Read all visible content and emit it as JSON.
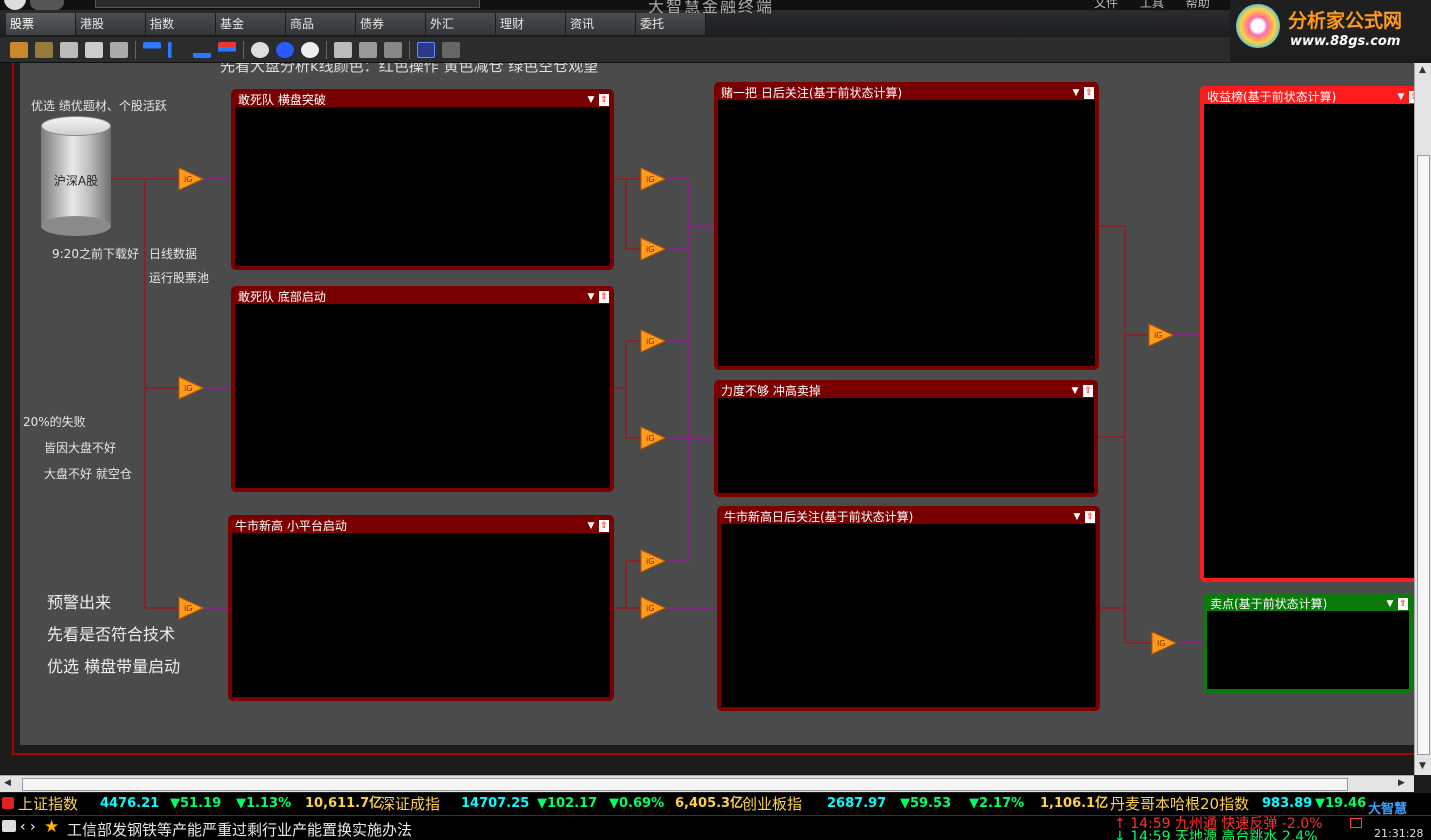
{
  "app": {
    "title": "大智慧金融终端",
    "system_menu": [
      "文件",
      "工具",
      "帮助",
      "资讯"
    ]
  },
  "tabs": [
    {
      "label": "股票",
      "active": true
    },
    {
      "label": "港股"
    },
    {
      "label": "指数"
    },
    {
      "label": "基金"
    },
    {
      "label": "商品"
    },
    {
      "label": "债券"
    },
    {
      "label": "外汇"
    },
    {
      "label": "理财"
    },
    {
      "label": "资讯"
    },
    {
      "label": "委托"
    }
  ],
  "watermark": {
    "name": "分析家公式网",
    "url": "www.88gs.com"
  },
  "canvas": {
    "top_hint": "先看大盘分析k线颜色：红色操作 黄色减仓 绿色空仓观望",
    "source": {
      "note_top": "优选 绩优题材、个股活跃",
      "cylinder_label": "沪深A股",
      "note_bottom": "9:20之前下载好"
    },
    "notes": {
      "daily": "日线数据",
      "pool": "运行股票池",
      "fail_1": "20%的失败",
      "fail_2": "皆因大盘不好",
      "fail_3": "大盘不好 就空仓",
      "warn_1": "预警出来",
      "warn_2": "先看是否符合技术",
      "warn_3": "优选 横盘带量启动"
    },
    "panels": [
      {
        "title": "敢死队 横盘突破"
      },
      {
        "title": "敢死队 底部启动"
      },
      {
        "title": "牛市新高 小平台启动"
      },
      {
        "title": "赌一把 日后关注(基于前状态计算)"
      },
      {
        "title": "力度不够 冲高卖掉"
      },
      {
        "title": "牛市新高日后关注(基于前状态计算)"
      },
      {
        "title": "收益榜(基于前状态计算)"
      },
      {
        "title": "卖点(基于前状态计算)"
      }
    ]
  },
  "ticker": [
    {
      "name": "上证指数",
      "value": "4476.21",
      "change": "▼51.19",
      "pct": "▼1.13%",
      "amount": "10,611.7亿"
    },
    {
      "name": "深证成指",
      "value": "14707.25",
      "change": "▼102.17",
      "pct": "▼0.69%",
      "amount": "6,405.3亿"
    },
    {
      "name": "创业板指",
      "value": "2687.97",
      "change": "▼59.53",
      "pct": "▼2.17%",
      "amount": "1,106.1亿"
    },
    {
      "name": "丹麦哥本哈根20指数",
      "value": "983.89",
      "change": "▼19.46"
    }
  ],
  "news": {
    "headline": "工信部发钢铁等产能严重过剩行业产能置换实施办法",
    "alerts": [
      {
        "text": "14:59 九州通  快速反弹 -2.0%",
        "dir": "up"
      },
      {
        "text": "14:59 天地源  高台跳水 2.4%",
        "dir": "dn"
      }
    ],
    "clock": "21:31:28",
    "brand": "大智慧"
  },
  "colors": {
    "panel_border": "#7a0000",
    "panel_highlight": "#ff1c1c",
    "panel_sell": "#0a7a0a",
    "wire": "#c000c0",
    "gate": "#ff9a1a"
  }
}
